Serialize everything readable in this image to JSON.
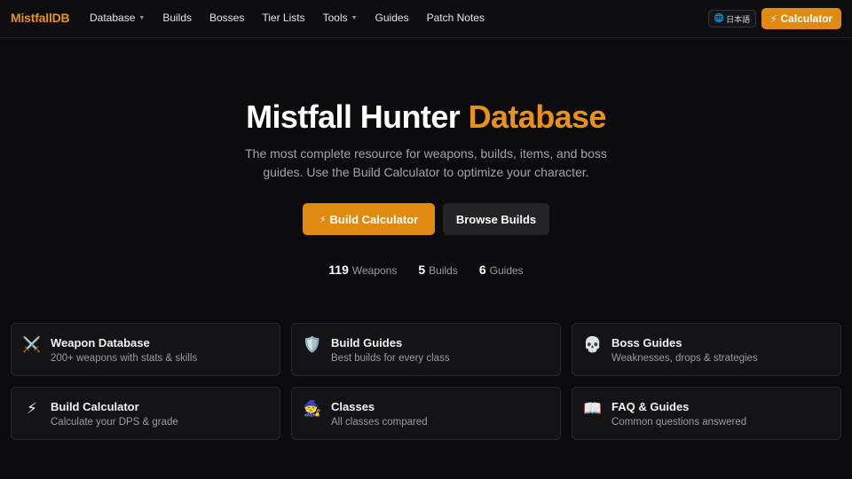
{
  "header": {
    "logo": "MistfallDB",
    "nav": [
      {
        "label": "Database",
        "dropdown": true
      },
      {
        "label": "Builds",
        "dropdown": false
      },
      {
        "label": "Bosses",
        "dropdown": false
      },
      {
        "label": "Tier Lists",
        "dropdown": false
      },
      {
        "label": "Tools",
        "dropdown": true
      },
      {
        "label": "Guides",
        "dropdown": false
      },
      {
        "label": "Patch Notes",
        "dropdown": false
      }
    ],
    "lang_label": "日本語",
    "lang_icon": "globe-icon",
    "calculator_label": "Calculator",
    "calculator_icon": "⚡"
  },
  "hero": {
    "title_main": "Mistfall Hunter",
    "title_accent": "Database",
    "subtitle": "The most complete resource for weapons, builds, items, and boss guides. Use the Build Calculator to optimize your character.",
    "primary_button": "Build Calculator",
    "primary_icon": "⚡",
    "secondary_button": "Browse Builds"
  },
  "stats": [
    {
      "value": "119",
      "label": "Weapons"
    },
    {
      "value": "5",
      "label": "Builds"
    },
    {
      "value": "6",
      "label": "Guides"
    }
  ],
  "cards": [
    {
      "icon": "⚔️",
      "icon_name": "crossed-swords-icon",
      "title": "Weapon Database",
      "desc": "200+ weapons with stats & skills"
    },
    {
      "icon": "🛡️",
      "icon_name": "shield-icon",
      "title": "Build Guides",
      "desc": "Best builds for every class"
    },
    {
      "icon": "💀",
      "icon_name": "skull-icon",
      "title": "Boss Guides",
      "desc": "Weaknesses, drops & strategies"
    },
    {
      "icon": "⚡",
      "icon_name": "lightning-icon",
      "title": "Build Calculator",
      "desc": "Calculate your DPS & grade"
    },
    {
      "icon": "🧙",
      "icon_name": "wizard-icon",
      "title": "Classes",
      "desc": "All classes compared"
    },
    {
      "icon": "📖",
      "icon_name": "book-icon",
      "title": "FAQ & Guides",
      "desc": "Common questions answered"
    }
  ],
  "colors": {
    "accent": "#e8921c",
    "button_primary": "#e08a12",
    "background": "#0c0c0e",
    "card_bg": "#141417"
  }
}
